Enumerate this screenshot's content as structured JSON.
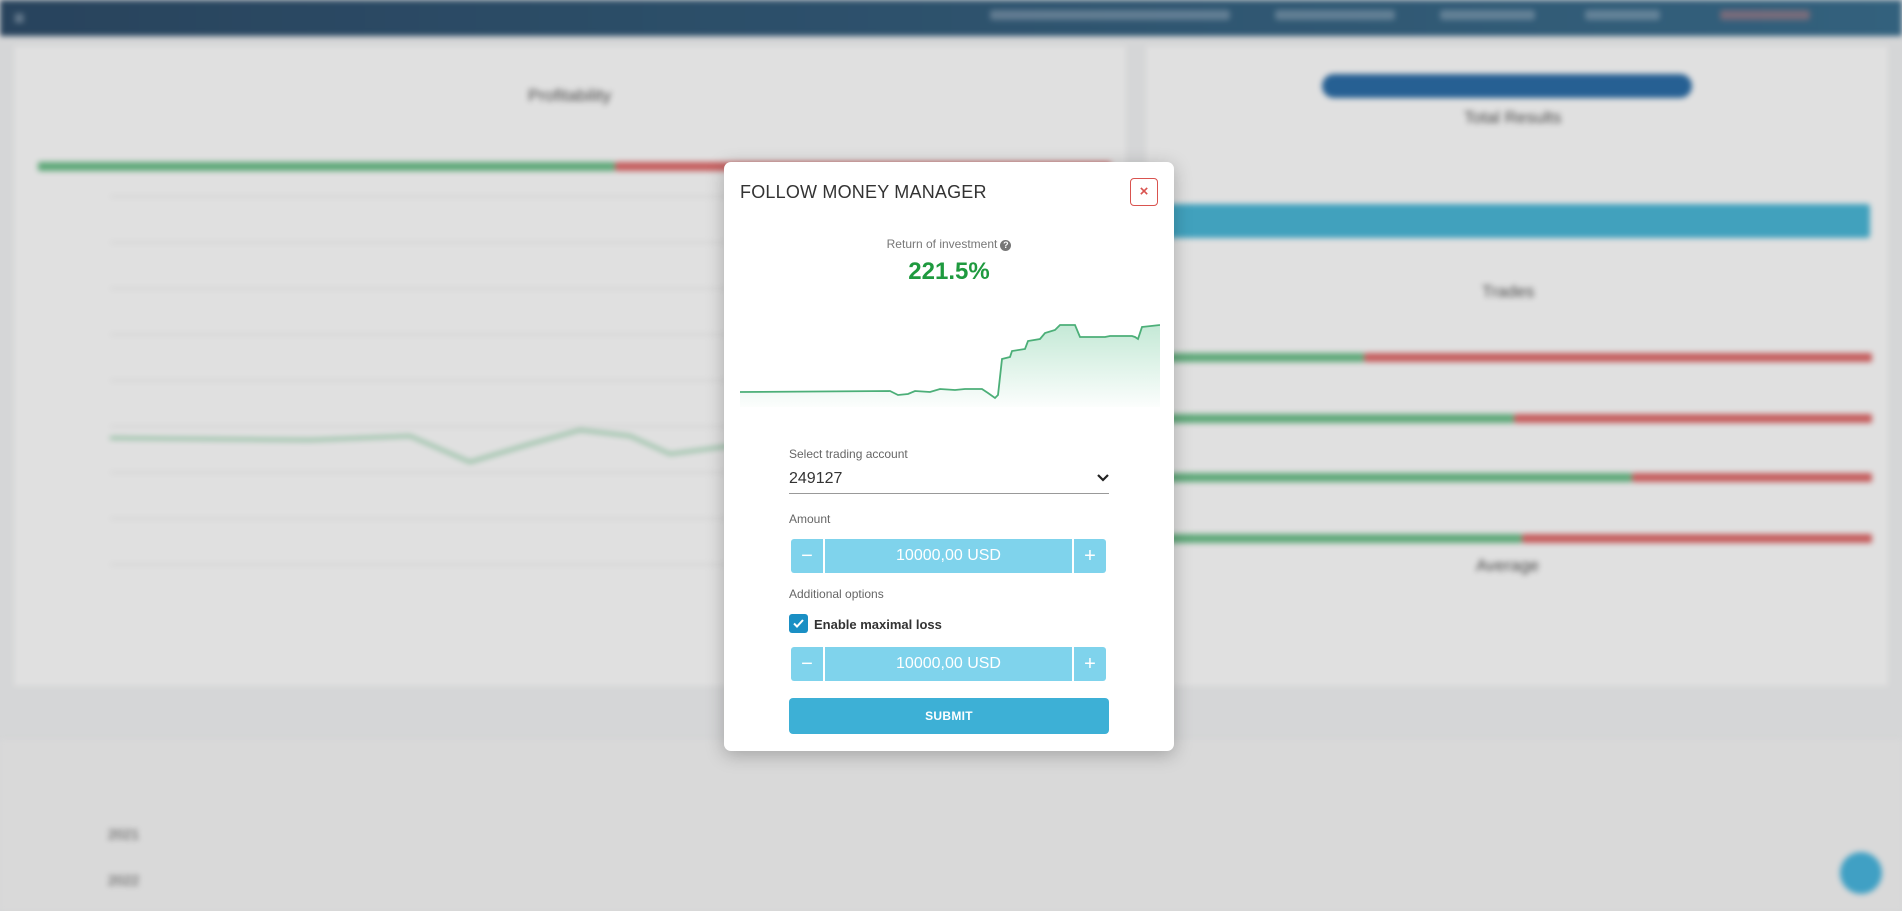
{
  "modal": {
    "title": "FOLLOW MONEY MANAGER",
    "close_label": "×",
    "roi_label": "Return of investment",
    "roi_value": "221.5%",
    "account_label": "Select trading account",
    "account_value": "249127",
    "amount_label": "Amount",
    "amount_value": "10000,00 USD",
    "additional_options_label": "Additional options",
    "max_loss_checked": true,
    "max_loss_label": "Enable maximal loss",
    "max_loss_value": "10000,00 USD",
    "minus_label": "−",
    "plus_label": "+",
    "submit_label": "SUBMIT",
    "accent_color": "#7fd3ec",
    "roi_color": "#1f9a3f"
  },
  "background": {
    "profitability_title": "Profitability",
    "trades_title": "Trades",
    "average_title": "Average",
    "total_results_title": "Total Results",
    "years": [
      "2021",
      "2022"
    ]
  }
}
